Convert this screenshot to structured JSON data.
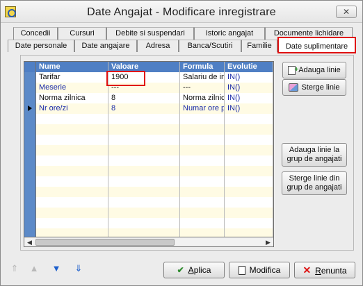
{
  "window": {
    "title": "Date Angajat - Modificare inregistrare",
    "close_glyph": "✕"
  },
  "tabs": {
    "back_row": [
      "Concedii",
      "Cursuri",
      "Debite si suspendari",
      "Istoric angajat",
      "Documente lichidare"
    ],
    "front_row": [
      "Date personale",
      "Date angajare",
      "Adresa",
      "Banca/Scutiri",
      "Familie",
      "Date suplimentare"
    ],
    "active": "Date suplimentare"
  },
  "grid": {
    "columns": [
      "Nume",
      "Valoare",
      "Formula",
      "Evolutie"
    ],
    "rows": [
      {
        "nume": "Tarifar",
        "valoare": "1900",
        "formula": "Salariu de in",
        "evolutie": "IN()"
      },
      {
        "nume": "Meserie",
        "valoare": "---",
        "formula": "---",
        "evolutie": "IN()"
      },
      {
        "nume": "Norma zilnica",
        "valoare": "8",
        "formula": "Norma zilnic",
        "evolutie": "IN()"
      },
      {
        "nume": "Nr ore/zi",
        "valoare": "8",
        "formula": "Numar ore p",
        "evolutie": "IN()"
      }
    ],
    "current_row": 3
  },
  "side_buttons": {
    "add_line": "Adauga linie",
    "delete_line": "Sterge linie",
    "add_group_1": "Adauga linie la",
    "add_group_2": "grup de angajati",
    "delete_group_1": "Sterge linie din",
    "delete_group_2": "grup de angajati"
  },
  "bottom": {
    "apply_prefix": "A",
    "apply_rest": "plica",
    "modify": "Modifica",
    "cancel_prefix": "R",
    "cancel_rest": "enunta",
    "nav_glyphs": [
      "⇑",
      "▲",
      "▼",
      "⇓"
    ]
  },
  "colors": {
    "highlight": "#e01010",
    "header": "#4f7fc4"
  }
}
